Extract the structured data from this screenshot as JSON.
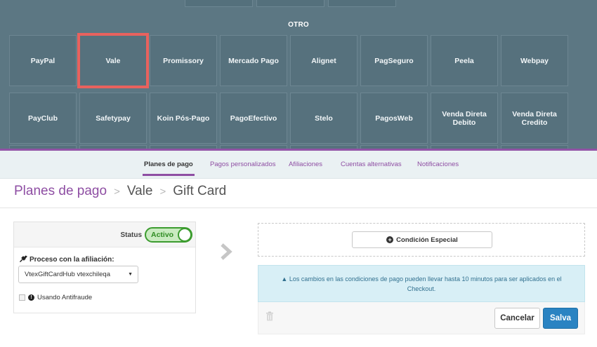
{
  "grid": {
    "section_title": "OTRO",
    "row1": [
      "PayPal",
      "Vale",
      "Promissory",
      "Mercado Pago",
      "Alignet",
      "PagSeguro",
      "Peela",
      "Webpay"
    ],
    "row2": [
      "PayClub",
      "Safetypay",
      "Koin Pós-Pago",
      "PagoEfectivo",
      "Stelo",
      "PagosWeb",
      "Venda Direta Debito",
      "Venda Direta Credito"
    ],
    "highlighted": "Vale",
    "highlight_color": "#e8625e"
  },
  "tabs": [
    {
      "label": "Planes de pago",
      "active": true
    },
    {
      "label": "Pagos personalizados",
      "active": false
    },
    {
      "label": "Afiliaciones",
      "active": false
    },
    {
      "label": "Cuentas alternativas",
      "active": false
    },
    {
      "label": "Notificaciones",
      "active": false
    }
  ],
  "breadcrumb": {
    "root": "Planes de pago",
    "separator": ">",
    "level1": "Vale",
    "level2": "Gift Card"
  },
  "config": {
    "status_label": "Status",
    "status_value": "Activo",
    "process_label": "Proceso con la afiliación:",
    "process_icon": "plug-icon",
    "affiliation_selected": "VtexGiftCardHub vtexchileqa",
    "antifraud_label": "Usando Antifraude",
    "antifraud_checked": false
  },
  "rules": {
    "special_condition_button": "Condición Especial",
    "alert_text": "Los cambios en las condiciones de pago pueden llevar hasta 10 minutos para ser aplicados en el Checkout.",
    "cancel_label": "Cancelar",
    "save_label": "Salva"
  },
  "colors": {
    "grid_bg": "#5c7783",
    "accent_purple": "#8e4ea3",
    "active_green": "#3c9c2f",
    "save_blue": "#2a83c2",
    "alert_bg": "#d8eff6"
  }
}
